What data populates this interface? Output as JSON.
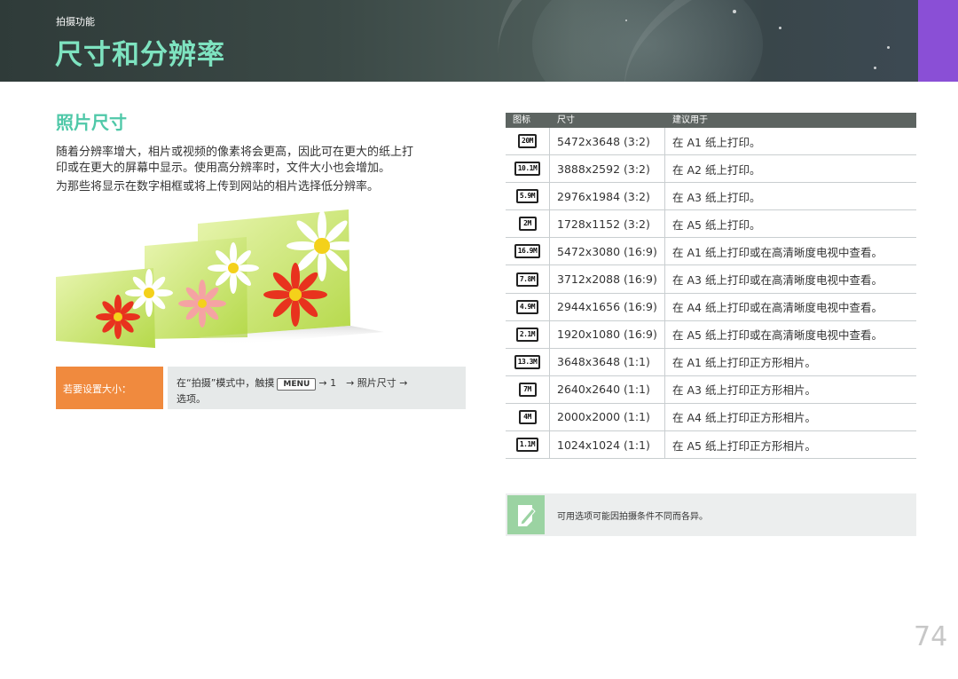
{
  "header": {
    "section_label": "拍摄功能",
    "title": "尺寸和分辨率"
  },
  "content": {
    "subtitle": "照片尺寸",
    "paragraph_lines": [
      "随着分辨率增大，相片或视频的像素将会更高，因此可在更大的纸上打",
      "印或在更大的屏幕中显示。使用高分辨率时，文件大小也会增加。",
      "为那些将显示在数字相框或将上传到网站的相片选择低分辨率。"
    ]
  },
  "howto": {
    "label": "若要设置大小：",
    "line1_before": "在“拍摄”模式中，触摸",
    "menu_key": "MENU",
    "line1_after": "→ 1　→ 照片尺寸 →",
    "line2": "选项。"
  },
  "table": {
    "headers": [
      "图标",
      "尺寸",
      "建议用于"
    ],
    "rows": [
      {
        "icon": "20M",
        "size": "5472x3648 (3:2)",
        "use": "在 A1 纸上打印。"
      },
      {
        "icon": "10.1M",
        "size": "3888x2592 (3:2)",
        "use": "在 A2 纸上打印。"
      },
      {
        "icon": "5.9M",
        "size": "2976x1984 (3:2)",
        "use": "在 A3 纸上打印。"
      },
      {
        "icon": "2M",
        "size": "1728x1152 (3:2)",
        "use": "在 A5 纸上打印。"
      },
      {
        "icon": "16.9M",
        "size": "5472x3080 (16:9)",
        "use": "在 A1 纸上打印或在高清晰度电视中查看。"
      },
      {
        "icon": "7.8M",
        "size": "3712x2088 (16:9)",
        "use": "在 A3 纸上打印或在高清晰度电视中查看。"
      },
      {
        "icon": "4.9M",
        "size": "2944x1656 (16:9)",
        "use": "在 A4 纸上打印或在高清晰度电视中查看。"
      },
      {
        "icon": "2.1M",
        "size": "1920x1080 (16:9)",
        "use": "在 A5 纸上打印或在高清晰度电视中查看。"
      },
      {
        "icon": "13.3M",
        "size": "3648x3648 (1:1)",
        "use": "在 A1 纸上打印正方形相片。"
      },
      {
        "icon": "7M",
        "size": "2640x2640 (1:1)",
        "use": "在 A3 纸上打印正方形相片。"
      },
      {
        "icon": "4M",
        "size": "2000x2000 (1:1)",
        "use": "在 A4 纸上打印正方形相片。"
      },
      {
        "icon": "1.1M",
        "size": "1024x1024 (1:1)",
        "use": "在 A5 纸上打印正方形相片。"
      }
    ]
  },
  "note": {
    "icon": "pencil-note-icon",
    "text": "可用选项可能因拍摄条件不同而各异。"
  },
  "page_number": "74",
  "colors": {
    "title": "#7ee3c0",
    "subtitle": "#4fc8a8",
    "accent_orange": "#f08a3e",
    "purple_tab": "#8a4fd6",
    "table_header": "#5d6461"
  }
}
